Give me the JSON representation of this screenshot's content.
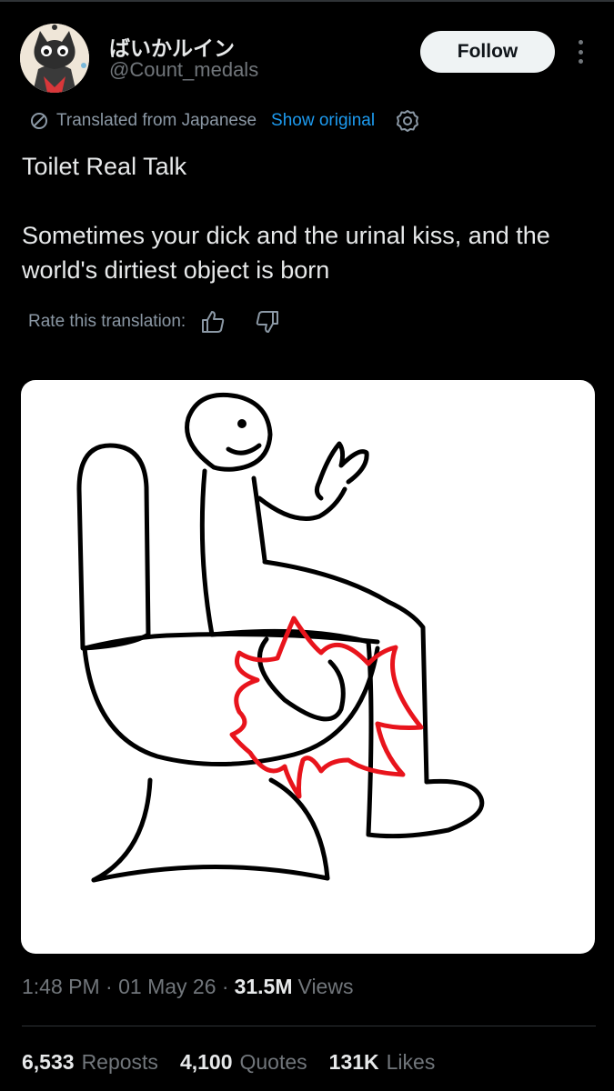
{
  "author": {
    "display_name": "ばいかルイン",
    "handle": "@Count_medals"
  },
  "follow_button": {
    "label": "Follow"
  },
  "translation": {
    "notice": "Translated from Japanese",
    "show_original": "Show original",
    "rate_label": "Rate this translation:"
  },
  "tweet": {
    "line1": "Toilet Real Talk",
    "line2": "Sometimes your dick and the urinal kiss, and the world's dirtiest object is born"
  },
  "meta": {
    "time": "1:48 PM",
    "date": "01 May 26",
    "views_count": "31.5M",
    "views_label": "Views"
  },
  "stats": {
    "reposts_count": "6,533",
    "reposts_label": "Reposts",
    "quotes_count": "4,100",
    "quotes_label": "Quotes",
    "likes_count": "131K",
    "likes_label": "Likes"
  },
  "colors": {
    "background": "#000000",
    "link": "#1d9bf0",
    "text": "#e7e9ea",
    "muted": "#71767b",
    "drawing_accent": "#e8141c"
  },
  "icons": [
    "translate-icon",
    "settings-icon",
    "thumbs-up-icon",
    "thumbs-down-icon",
    "more-icon"
  ]
}
